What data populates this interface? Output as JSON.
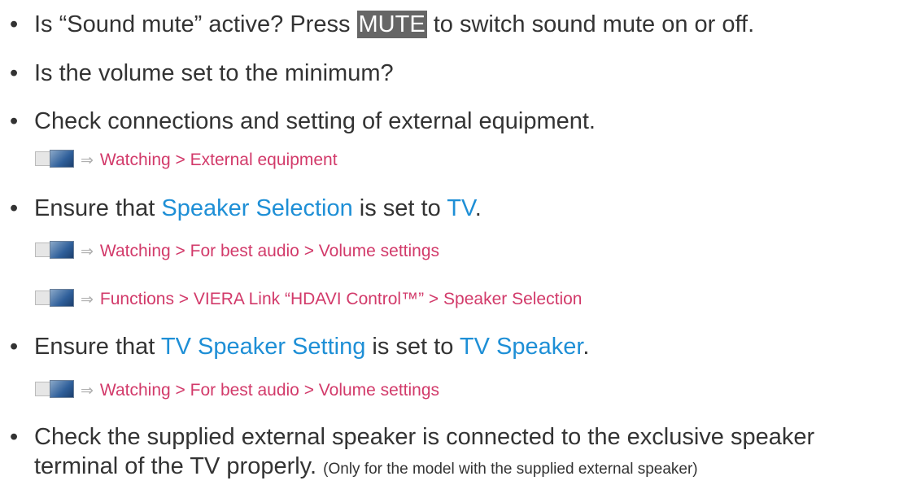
{
  "items": [
    {
      "before": "Is “Sound mute” active? Press ",
      "key": "MUTE",
      "after": " to switch sound mute on or off."
    },
    {
      "text": "Is the volume set to the minimum?"
    },
    {
      "text": "Check connections and setting of external equipment."
    },
    {
      "before": "Ensure that ",
      "link1": "Speaker Selection",
      "middle": " is set to ",
      "link2": "TV",
      "after": "."
    },
    {
      "before": "Ensure that ",
      "link1": "TV Speaker Setting",
      "middle": " is set to ",
      "link2": "TV Speaker",
      "after": "."
    },
    {
      "line1": "Check the supplied external speaker is connected to the exclusive speaker",
      "line2": "terminal of the TV properly.",
      "note": "(Only for the model with the supplied external speaker)"
    }
  ],
  "refs": [
    {
      "text": "Watching > External equipment"
    },
    {
      "text": "Watching > For best audio > Volume settings"
    },
    {
      "text": "Functions > VIERA Link “HDAVI Control™” > Speaker Selection"
    },
    {
      "text": "Watching > For best audio > Volume settings"
    }
  ],
  "bullet": "•",
  "arrow": "⇒",
  "colors": {
    "link": "#1e8fd6",
    "ref": "#d23a6a",
    "key_bg": "#666666",
    "text": "#333333"
  }
}
